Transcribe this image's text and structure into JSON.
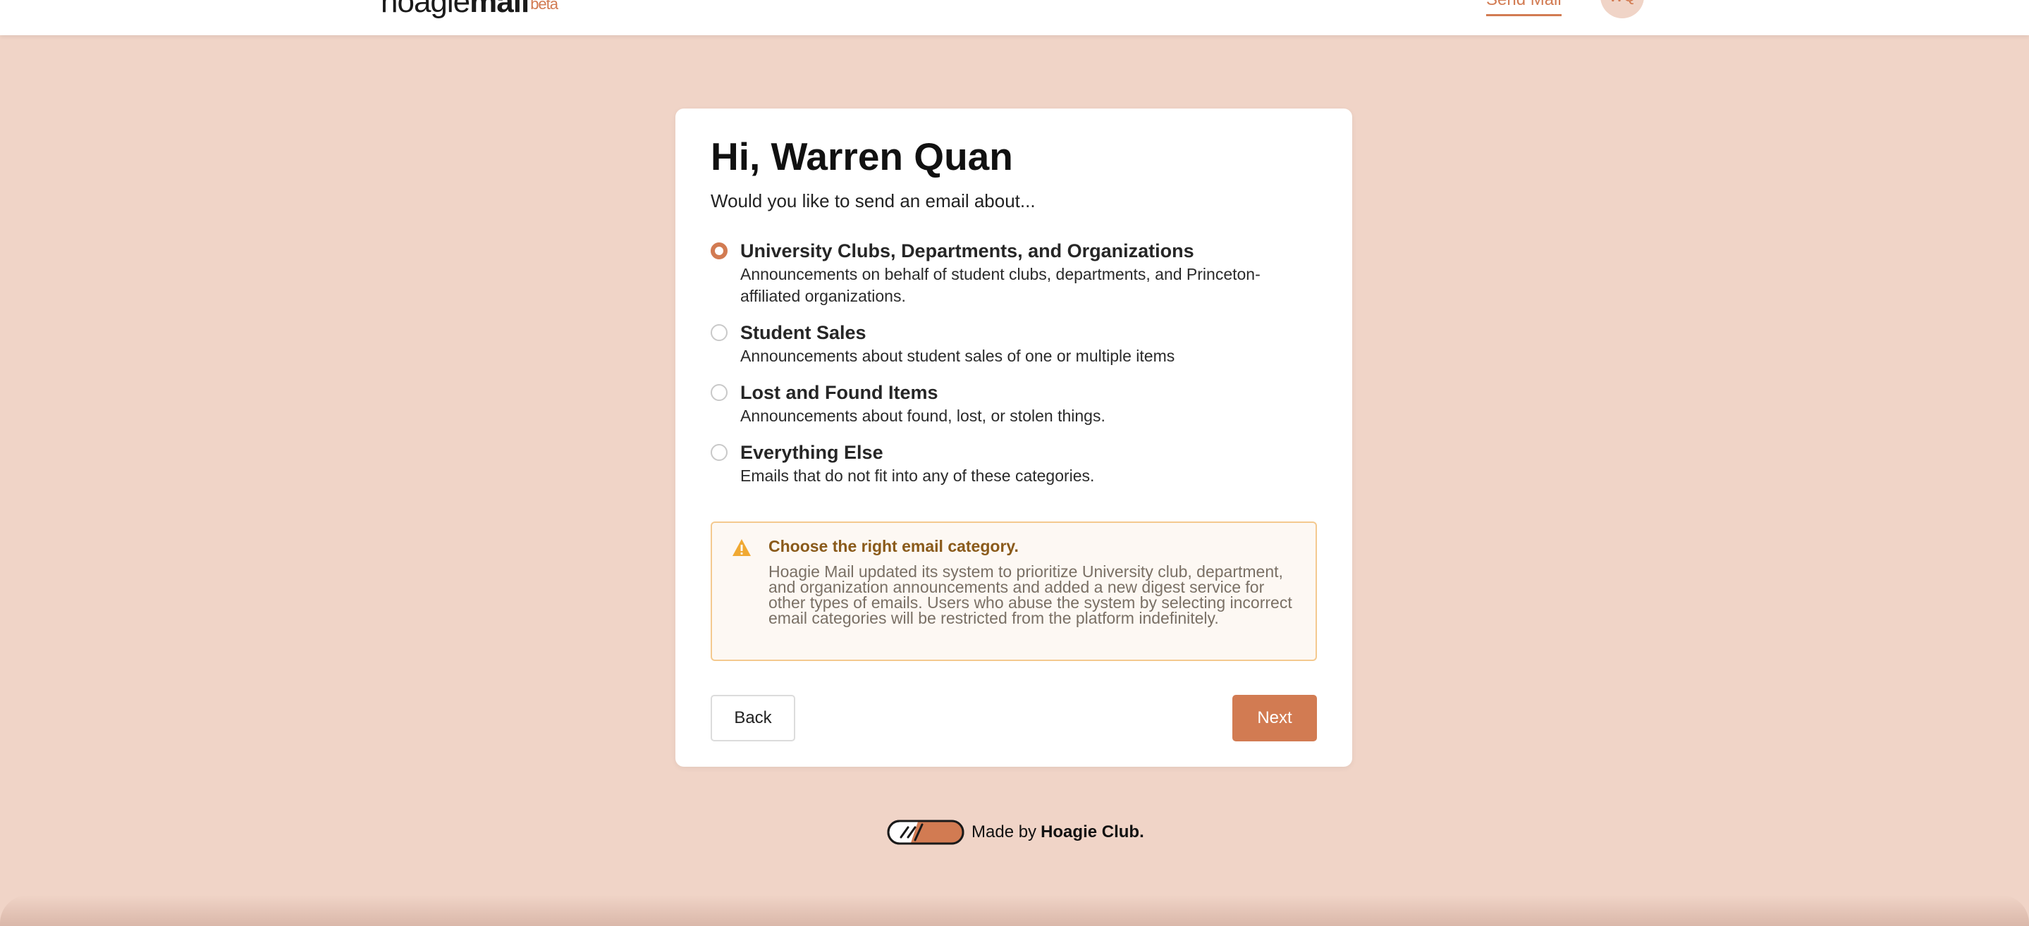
{
  "header": {
    "logo_prefix": "hoagie",
    "logo_mail": "mail",
    "logo_beta": "beta",
    "nav_send_mail": "Send Mail",
    "avatar_initials": "WQ"
  },
  "card": {
    "title": "Hi, Warren Quan",
    "subtitle": "Would you like to send an email about...",
    "options": [
      {
        "title": "University Clubs, Departments, and Organizations",
        "description": "Announcements on behalf of student clubs, departments, and Princeton-affiliated organizations.",
        "selected": true
      },
      {
        "title": "Student Sales",
        "description": "Announcements about student sales of one or multiple items",
        "selected": false
      },
      {
        "title": "Lost and Found Items",
        "description": "Announcements about found, lost, or stolen things.",
        "selected": false
      },
      {
        "title": "Everything Else",
        "description": "Emails that do not fit into any of these categories.",
        "selected": false
      }
    ],
    "alert": {
      "icon": "warning-icon",
      "title": "Choose the right email category.",
      "body": "Hoagie Mail updated its system to prioritize University club, department, and organization announcements and added a new digest service for other types of emails. Users who abuse the system by selecting incorrect email categories will be restricted from the platform indefinitely."
    },
    "back_label": "Back",
    "next_label": "Next"
  },
  "footer": {
    "made_by": "Made by",
    "club": "Hoagie Club."
  },
  "colors": {
    "accent": "#d27b52",
    "background": "#f0d4c7",
    "alert_border": "#f4c98f",
    "alert_icon": "#f0a933"
  }
}
